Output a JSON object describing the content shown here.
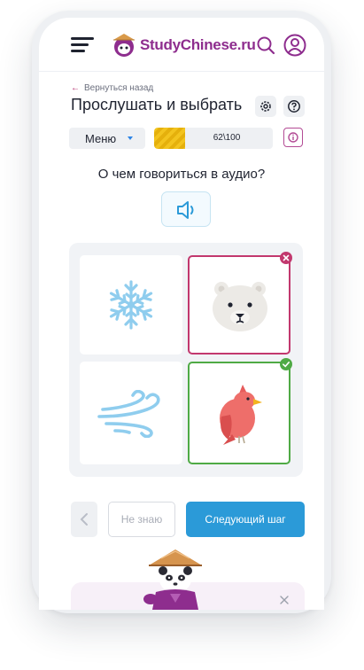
{
  "header": {
    "logo_study": "Study",
    "logo_chinese": "Chinese.ru",
    "menu_icon": "hamburger-icon",
    "search_icon": "search-icon",
    "user_icon": "user-icon"
  },
  "nav": {
    "back_label": "Вернуться назад",
    "back_icon": "arrow-left-icon"
  },
  "page": {
    "title": "Прослушать и выбрать",
    "settings_icon": "gear-icon",
    "help_icon": "question-icon"
  },
  "toolbar": {
    "menu_label": "Меню",
    "progress_text": "62\\100",
    "progress_fraction": 0.26,
    "info_icon": "info-icon"
  },
  "exercise": {
    "question": "О чем говориться в аудио?",
    "audio_icon": "speaker-icon",
    "options": [
      {
        "image": "snowflake",
        "state": "neutral"
      },
      {
        "image": "polar-bear",
        "state": "wrong"
      },
      {
        "image": "wind",
        "state": "neutral"
      },
      {
        "image": "red-bird",
        "state": "correct"
      }
    ]
  },
  "actions": {
    "prev_icon": "chevron-left-icon",
    "dont_know_label": "Не знаю",
    "next_label": "Следующий шаг"
  },
  "promo": {
    "close_icon": "close-icon",
    "mascot": "panda-mascot"
  },
  "colors": {
    "brand_purple": "#8e2d8e",
    "primary_blue": "#2b9ad8",
    "wrong": "#c2386e",
    "correct": "#4faa45",
    "progress_yellow": "#f3c41e"
  }
}
